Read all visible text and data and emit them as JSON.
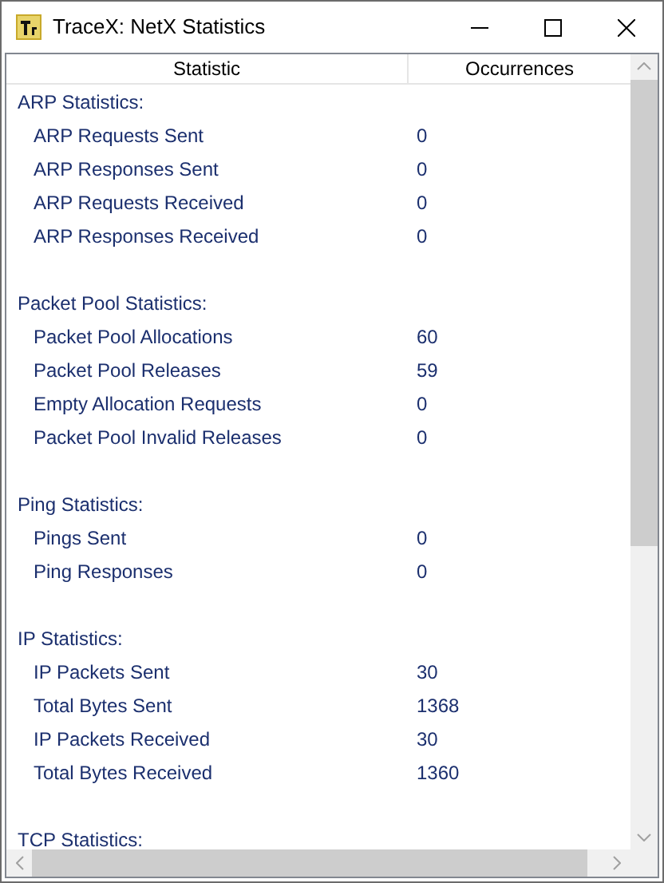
{
  "window": {
    "title": "TraceX: NetX Statistics"
  },
  "table": {
    "columns": [
      "Statistic",
      "Occurrences"
    ],
    "groups": [
      {
        "heading": "ARP Statistics:",
        "rows": [
          {
            "label": "ARP Requests Sent",
            "value": "0"
          },
          {
            "label": "ARP Responses Sent",
            "value": "0"
          },
          {
            "label": "ARP Requests Received",
            "value": "0"
          },
          {
            "label": "ARP Responses Received",
            "value": "0"
          }
        ]
      },
      {
        "heading": "Packet Pool Statistics:",
        "rows": [
          {
            "label": "Packet Pool Allocations",
            "value": "60"
          },
          {
            "label": "Packet Pool Releases",
            "value": "59"
          },
          {
            "label": "Empty Allocation Requests",
            "value": "0"
          },
          {
            "label": "Packet Pool Invalid Releases",
            "value": "0"
          }
        ]
      },
      {
        "heading": "Ping Statistics:",
        "rows": [
          {
            "label": "Pings Sent",
            "value": "0"
          },
          {
            "label": "Ping Responses",
            "value": "0"
          }
        ]
      },
      {
        "heading": "IP Statistics:",
        "rows": [
          {
            "label": "IP Packets Sent",
            "value": "30"
          },
          {
            "label": "Total Bytes Sent",
            "value": "1368"
          },
          {
            "label": "IP Packets Received",
            "value": "30"
          },
          {
            "label": "Total Bytes Received",
            "value": "1360"
          }
        ]
      },
      {
        "heading": "TCP Statistics:"
      }
    ]
  }
}
